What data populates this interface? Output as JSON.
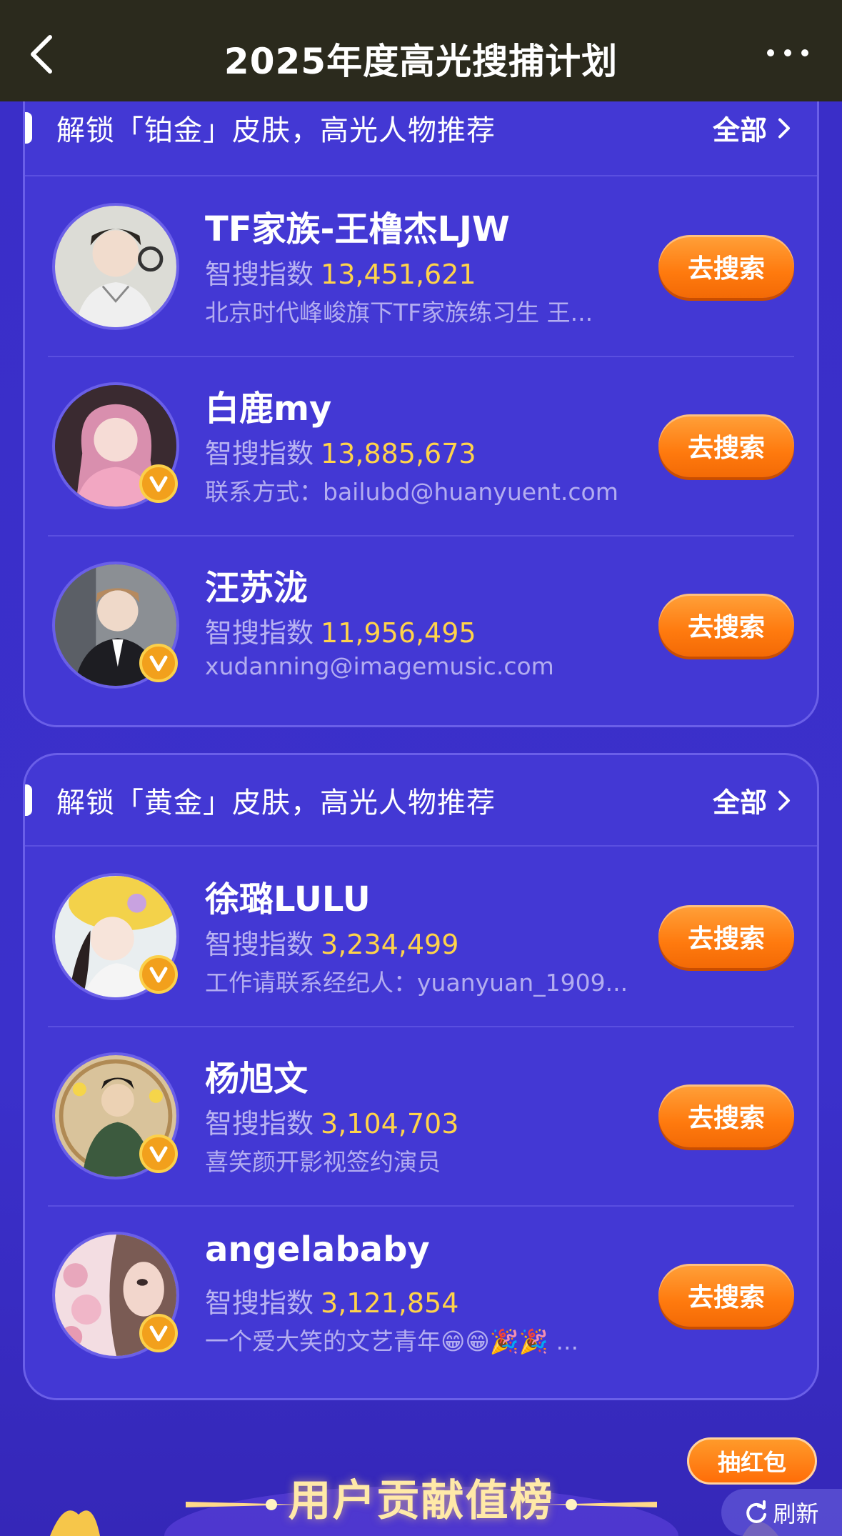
{
  "nav": {
    "title": "2025年度高光搜捕计划"
  },
  "colors": {
    "topbar": "#2b2a1d",
    "panel": "#4338d4",
    "accent_value": "#ffd34a",
    "button": "#ff7a0e"
  },
  "sections": [
    {
      "title": "解锁「铂金」皮肤，高光人物推荐",
      "all_label": "全部",
      "items": [
        {
          "name": "TF家族-王橹杰LJW",
          "index_label": "智搜指数",
          "index_value": "13,451,621",
          "desc": "北京时代峰峻旗下TF家族练习生 王...",
          "button": "去搜索",
          "verified": false
        },
        {
          "name": "白鹿my",
          "index_label": "智搜指数",
          "index_value": "13,885,673",
          "desc": "联系方式：bailubd@huanyuent.com",
          "button": "去搜索",
          "verified": true
        },
        {
          "name": "汪苏泷",
          "index_label": "智搜指数",
          "index_value": "11,956,495",
          "desc": "xudanning@imagemusic.com",
          "button": "去搜索",
          "verified": true
        }
      ]
    },
    {
      "title": "解锁「黄金」皮肤，高光人物推荐",
      "all_label": "全部",
      "items": [
        {
          "name": "徐璐LULU",
          "index_label": "智搜指数",
          "index_value": "3,234,499",
          "desc": "工作请联系经纪人：yuanyuan_1909...",
          "button": "去搜索",
          "verified": true
        },
        {
          "name": "杨旭文",
          "index_label": "智搜指数",
          "index_value": "3,104,703",
          "desc": "喜笑颜开影视签约演员",
          "button": "去搜索",
          "verified": true
        },
        {
          "name": "angelababy",
          "index_label": "智搜指数",
          "index_value": "3,121,854",
          "desc": "一个爱大笑的文艺青年😁😁🎉🎉 ...",
          "button": "去搜索",
          "verified": true
        }
      ]
    }
  ],
  "banner": {
    "title": "用户贡献值榜",
    "red_packet": "抽红包",
    "refresh": "刷新"
  }
}
